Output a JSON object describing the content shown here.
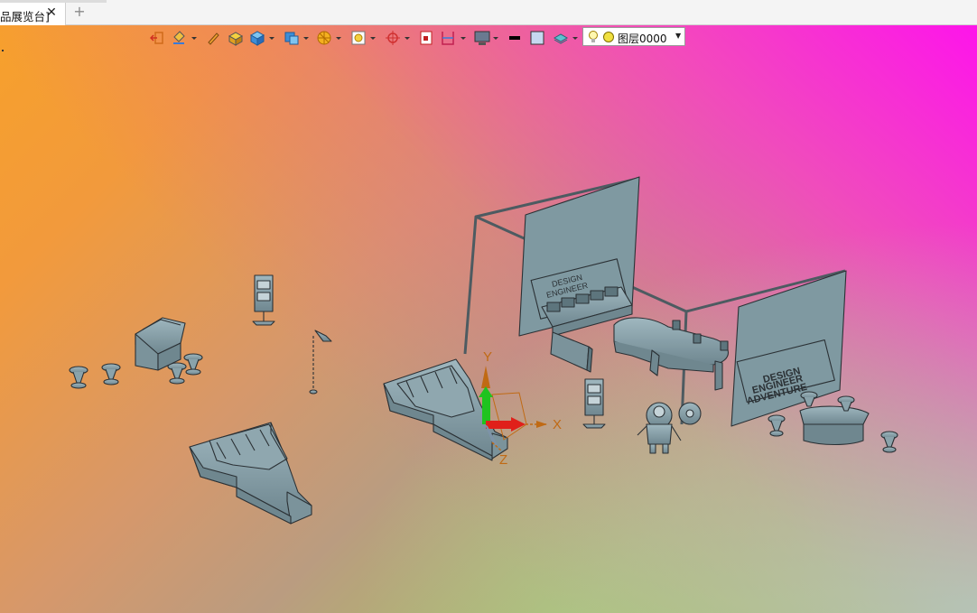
{
  "tab": {
    "label": "品展览台]",
    "close_glyph": "✕",
    "add_glyph": "+"
  },
  "toolbar": {
    "layer_value": "图层0000",
    "tools": [
      "exit-sketch-icon",
      "paint-bucket-icon",
      "pencil-icon",
      "display-box-icon",
      "cube-view-icon",
      "multi-view-icon",
      "render-style-icon",
      "zoom-icon",
      "snap-icon",
      "fit-view-icon",
      "section-icon",
      "monitor-icon",
      "line-color-icon",
      "fill-color-icon",
      "layer-manager-icon",
      "bulb-icon",
      "layer-dot-icon"
    ]
  },
  "axes": {
    "x_label": "X",
    "y_label": "Y",
    "z_label": "Z"
  },
  "colors": {
    "model": "#7f99a1",
    "model_dark": "#2b3135",
    "axis_x": "#e0201a",
    "axis_y": "#1fc31f",
    "axis_z": "#7d93a8",
    "axis_label": "#c06a14",
    "bg_top_left": "#f7a12a",
    "bg_top_right": "#ff10ee",
    "bg_bottom_left": "#9adb2c",
    "bg_bottom_right": "#b5c5b8"
  },
  "scene": {
    "banner_text_right": [
      "DESIGN",
      "ENGINEER",
      "ADVENTURE"
    ]
  }
}
